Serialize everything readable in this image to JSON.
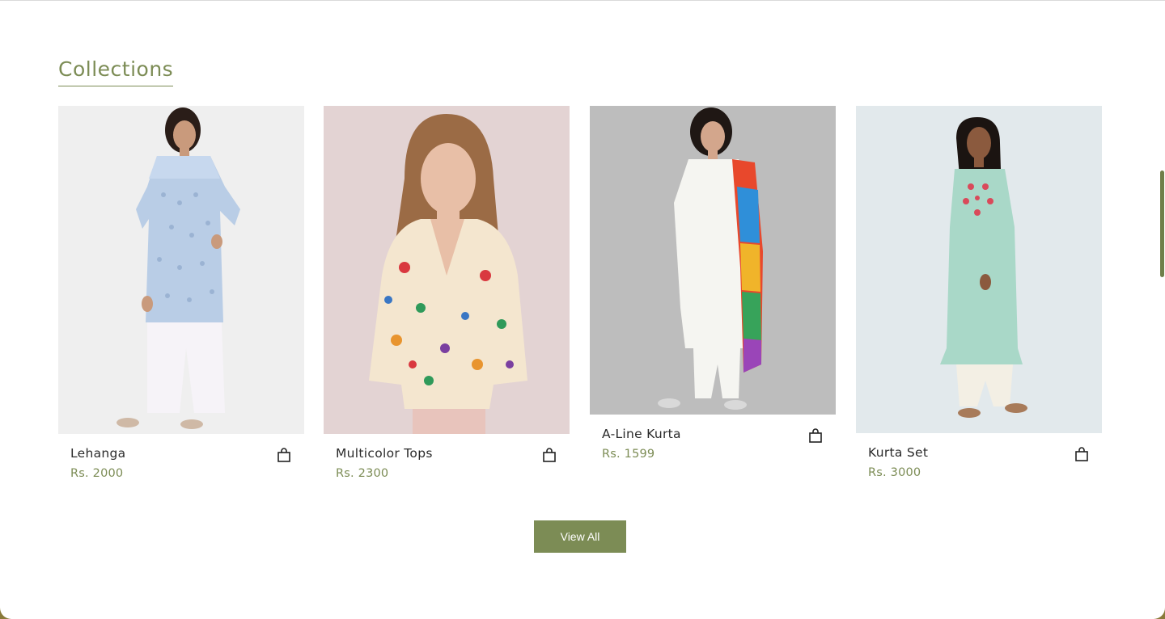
{
  "section": {
    "title": "Collections"
  },
  "products": [
    {
      "name": "Lehanga",
      "price": "Rs. 2000",
      "image": "woman in blue printed kurta with white palazzo",
      "bg": "#efefef"
    },
    {
      "name": "Multicolor Tops",
      "price": "Rs. 2300",
      "image": "woman in floral multicolor top",
      "bg": "#e6d6d6"
    },
    {
      "name": "A-Line Kurta",
      "price": "Rs. 1599",
      "image": "woman in white kurta with multicolor dupatta",
      "bg": "#bfbfbf"
    },
    {
      "name": "Kurta Set",
      "price": "Rs. 3000",
      "image": "woman in mint green embroidered kurta",
      "bg": "#dfe7ea"
    }
  ],
  "cta": {
    "label": "View All"
  },
  "colors": {
    "accent": "#7c8c55",
    "text": "#2a2a2a"
  },
  "icons": {
    "bag": "shopping-bag-icon"
  }
}
